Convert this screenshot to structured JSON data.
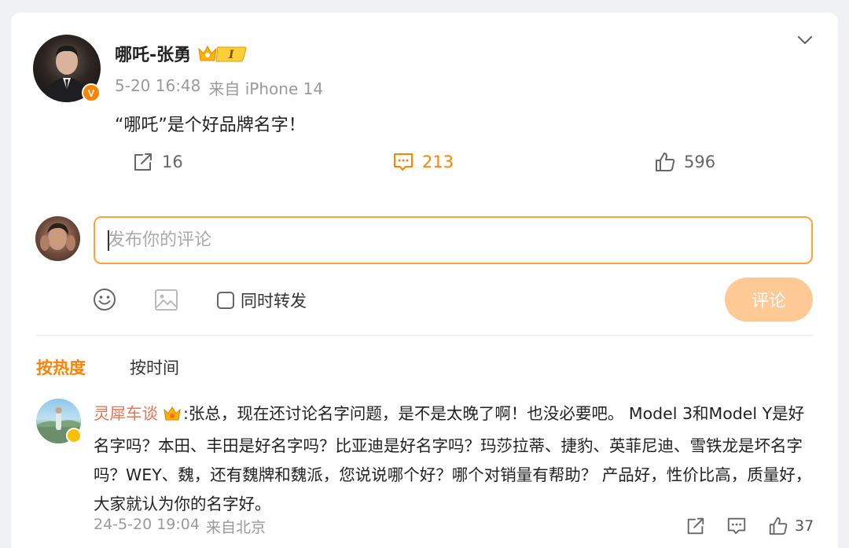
{
  "post": {
    "author_name": "哪吒-张勇",
    "vip_level": "I",
    "time": "5-20 16:48",
    "source": "来自 iPhone 14",
    "content": "“哪吒”是个好品牌名字！",
    "repost_count": "16",
    "comment_count": "213",
    "like_count": "596"
  },
  "composer": {
    "placeholder": "发布你的评论",
    "repost_label": "同时转发",
    "submit_label": "评论"
  },
  "sort": {
    "hot_label": "按热度",
    "time_label": "按时间"
  },
  "comments": [
    {
      "user": "灵犀车谈",
      "text": ":张总，现在还讨论名字问题，是不是太晚了啊！也没必要吧。 Model 3和Model Y是好名字吗？本田、丰田是好名字吗？比亚迪是好名字吗？玛莎拉蒂、捷豹、英菲尼迪、雪铁龙是坏名字吗？WEY、魏，还有魏牌和魏派，您说说哪个好？哪个对销量有帮助？ 产品好，性价比高，质量好，大家就认为你的名字好。",
      "time": "24-5-20 19:04",
      "source": "来自北京",
      "like_count": "37"
    }
  ],
  "colors": {
    "accent": "#ff8200",
    "input_border": "#ffa23a",
    "submit_disabled": "#ffc995",
    "username": "#eb7350"
  }
}
